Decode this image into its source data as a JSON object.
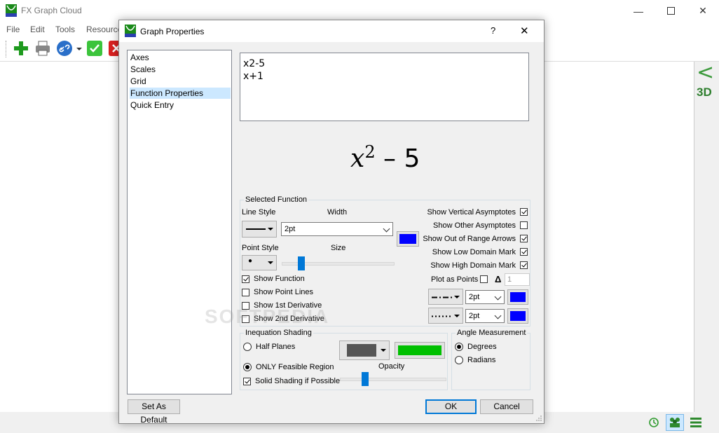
{
  "app": {
    "title": "FX Graph Cloud",
    "menu": [
      "File",
      "Edit",
      "Tools",
      "Resource"
    ],
    "side": {
      "collapse_glyph": "<",
      "three_d": "3D"
    }
  },
  "dialog": {
    "title": "Graph Properties",
    "help_glyph": "?",
    "close_glyph": "✕",
    "nav": [
      {
        "label": "Axes",
        "selected": false
      },
      {
        "label": "Scales",
        "selected": false
      },
      {
        "label": "Grid",
        "selected": false
      },
      {
        "label": "Function Properties",
        "selected": true
      },
      {
        "label": "Quick Entry",
        "selected": false
      }
    ],
    "functions_text": "x2-5\nx+1",
    "formula": {
      "base": "x",
      "exponent": "2",
      "rest": " – 5"
    },
    "selected_function": {
      "group_label": "Selected Function",
      "line_style_label": "Line Style",
      "width_label": "Width",
      "width_value": "2pt",
      "point_style_label": "Point Style",
      "size_label": "Size",
      "point_glyph": "●",
      "line_color": "#0000ff",
      "size_level": 0.15,
      "checks": [
        {
          "label": "Show Function",
          "checked": true
        },
        {
          "label": "Show Point Lines",
          "checked": false
        },
        {
          "label": "Show 1st Derivative",
          "checked": false
        },
        {
          "label": "Show 2nd Derivative",
          "checked": false
        }
      ],
      "right_checks": [
        {
          "label": "Show Vertical Asymptotes",
          "checked": true
        },
        {
          "label": "Show Other Asymptotes",
          "checked": false
        },
        {
          "label": "Show Out of Range Arrows",
          "checked": true
        },
        {
          "label": "Show Low Domain Mark",
          "checked": true
        },
        {
          "label": "Show High Domain Mark",
          "checked": true
        }
      ],
      "plot_as_points_label": "Plot as Points",
      "plot_as_points_checked": false,
      "delta_glyph": "Δ",
      "delta_value": "1",
      "deriv1_width": "2pt",
      "deriv2_width": "2pt",
      "deriv1_color": "#0000ff",
      "deriv2_color": "#0000ff"
    },
    "inequation": {
      "group_label": "Inequation Shading",
      "radios": [
        {
          "label": "Half Planes",
          "selected": false
        },
        {
          "label": "ONLY Feasible Region",
          "selected": true
        }
      ],
      "solid_label": "Solid Shading if Possible",
      "solid_checked": true,
      "opacity_label": "Opacity",
      "opacity_level": 0.22,
      "shade_color": "#555555",
      "region_color": "#00c000"
    },
    "angle": {
      "group_label": "Angle Measurement",
      "radios": [
        {
          "label": "Degrees",
          "selected": true
        },
        {
          "label": "Radians",
          "selected": false
        }
      ]
    },
    "buttons": {
      "set_default": "Set As Default",
      "ok": "OK",
      "cancel": "Cancel"
    }
  },
  "watermark": "SOFTPEDIA"
}
